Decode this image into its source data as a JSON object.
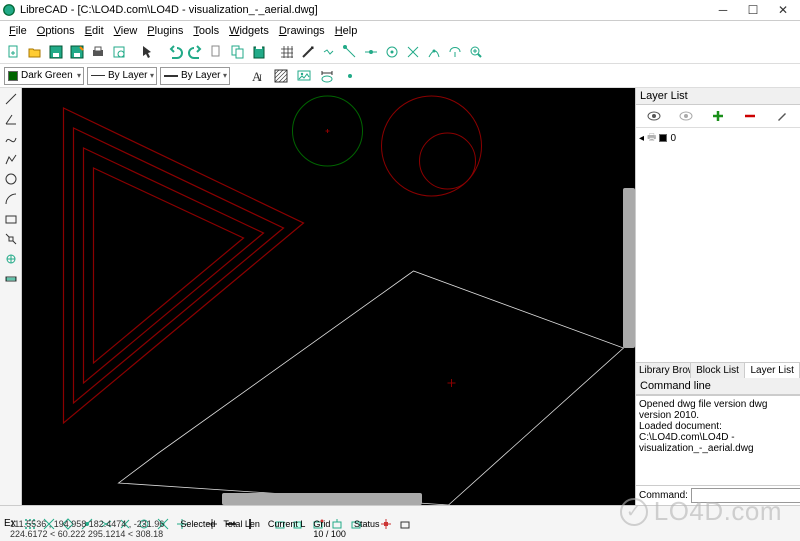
{
  "window": {
    "app_name": "LibreCAD",
    "title_separator": " - ",
    "document_path": "[C:\\LO4D.com\\LO4D - visualization_-_aerial.dwg]"
  },
  "menubar": [
    "File",
    "Options",
    "Edit",
    "View",
    "Plugins",
    "Tools",
    "Widgets",
    "Drawings",
    "Help"
  ],
  "toolbar1_icons": [
    "new-icon",
    "open-icon",
    "save-icon",
    "saveas-icon",
    "print-icon",
    "print-preview-icon",
    "undo-icon",
    "redo-icon",
    "cut-icon",
    "copy-icon",
    "paste-icon",
    "grid-icon",
    "ortho-icon",
    "snap-end-icon",
    "snap-mid-icon",
    "snap-center-icon",
    "snap-int-icon",
    "snap-dist-icon",
    "zoom-out-icon",
    "zoom-in-icon"
  ],
  "layer_combo": {
    "color_label": "Dark Green",
    "linetype": "By Layer",
    "lineweight": "By Layer"
  },
  "toolbar2_icons": [
    "text-icon",
    "hatch-icon",
    "image-icon",
    "dimension-icon",
    "point-mode-icon"
  ],
  "left_tools": [
    "line-tool",
    "polyline-tool",
    "spline-tool",
    "circle-tool",
    "arc-tool",
    "rect-tool",
    "ellipse-tool",
    "move-tool",
    "rotate-tool",
    "mirror-tool",
    "hatch-tool"
  ],
  "right_panel": {
    "layer_list_title": "Layer List",
    "layer_row_name": "0",
    "tabs": [
      "Library Browser",
      "Block List",
      "Layer List"
    ],
    "active_tab": 2,
    "cmd_title": "Command line",
    "cmd_log": [
      "Opened dwg file version dwg version 2010.",
      "Loaded document: C:\\LO4D.com\\LO4D - visualization_-_aerial.dwg"
    ],
    "cmd_label": "Command:"
  },
  "statusbar": {
    "ex_label": "Ex",
    "coords_line1": "111.5536 , 194.958 182.4474 , -231.96",
    "coords_line2": "224.6172 < 60.222 295.1214 < 308.18",
    "cols": [
      "Selected",
      "Total Len",
      "Current L",
      "Grid",
      "Status"
    ],
    "grid_value": "10 / 100"
  },
  "watermark": "LO4D.com"
}
